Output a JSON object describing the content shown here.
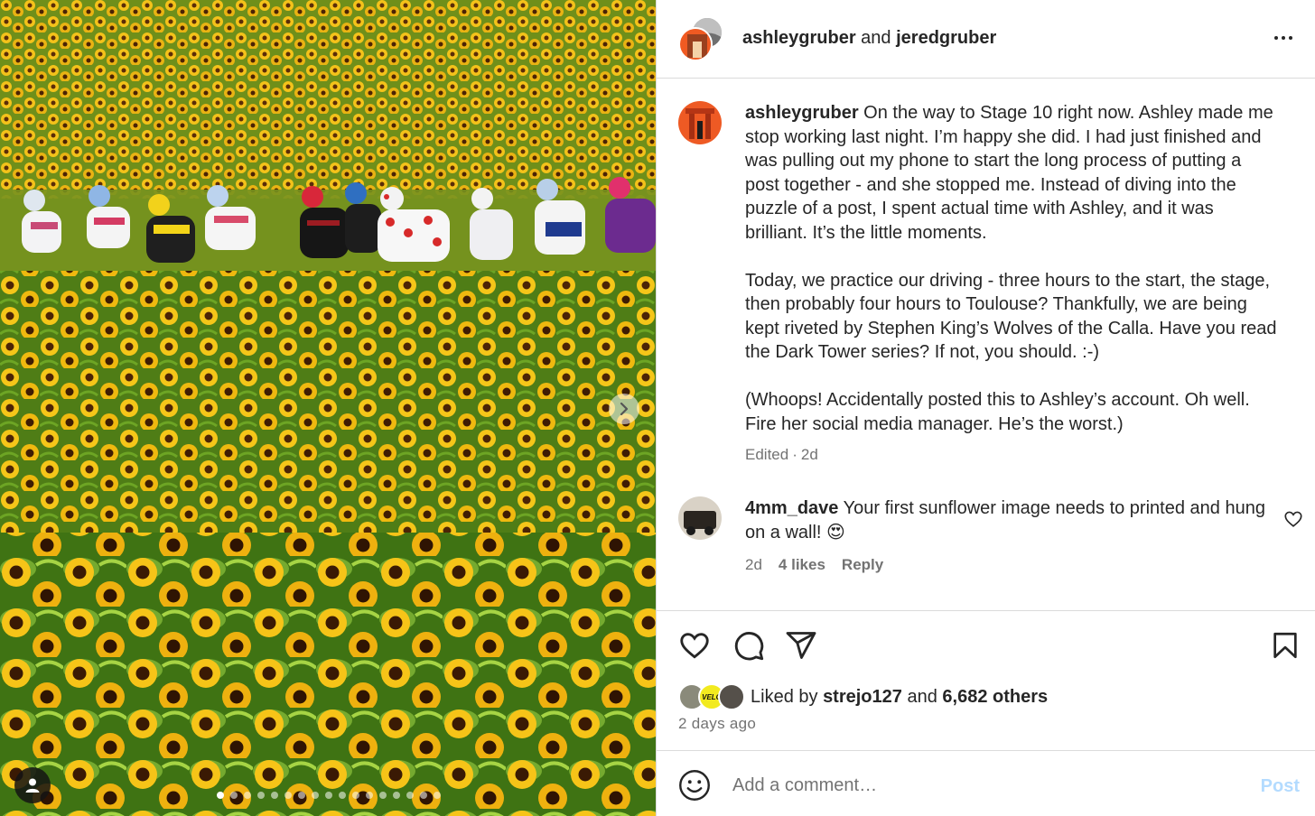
{
  "post": {
    "image_alt": "Cyclists riding through a sunflower field",
    "carousel": {
      "total_slides": 17,
      "active_index": 0
    },
    "header": {
      "owner1": "ashleygruber",
      "joiner": "and",
      "owner2": "jeredgruber"
    },
    "caption": {
      "username": "ashleygruber",
      "text": " On the way to Stage 10 right now. Ashley made me stop working last night. I’m happy she did. I had just finished and was pulling out my phone to start the long process of putting a post together - and she stopped me. Instead of diving into the puzzle of a post, I spent actual time with Ashley, and it was brilliant. It’s the little moments.\n\nToday, we practice our driving - three hours to the start, the stage, then probably four hours to Toulouse? Thankfully, we are being kept riveted by Stephen King’s Wolves of the Calla. Have you read the Dark Tower series? If not, you should. :-)\n\n(Whoops! Accidentally posted this to Ashley’s account. Oh well. Fire her social media manager. He’s the worst.)",
      "edited": "Edited",
      "separator": "·",
      "age": "2d"
    },
    "comments": [
      {
        "username": "4mm_dave",
        "text": " Your first sunflower image needs to printed and hung on a wall! 😍",
        "age": "2d",
        "likes": "4 likes",
        "reply": "Reply"
      }
    ],
    "likes": {
      "prefix": "Liked by",
      "user": "strejo127",
      "joiner": "and",
      "others": "6,682 others",
      "liker_badge": "VELO"
    },
    "posted": "2 days ago",
    "composer": {
      "placeholder": "Add a comment…",
      "post_label": "Post"
    }
  },
  "colors": {
    "text": "#262626",
    "muted": "#737373",
    "border": "#dbdbdb",
    "post_disabled": "#b3dbff",
    "sunflower": "#f3c21a"
  },
  "icons": [
    "more-icon",
    "heart-icon",
    "comment-icon",
    "share-icon",
    "bookmark-icon",
    "emoji-icon",
    "chevron-right-icon",
    "user-tag-icon"
  ]
}
